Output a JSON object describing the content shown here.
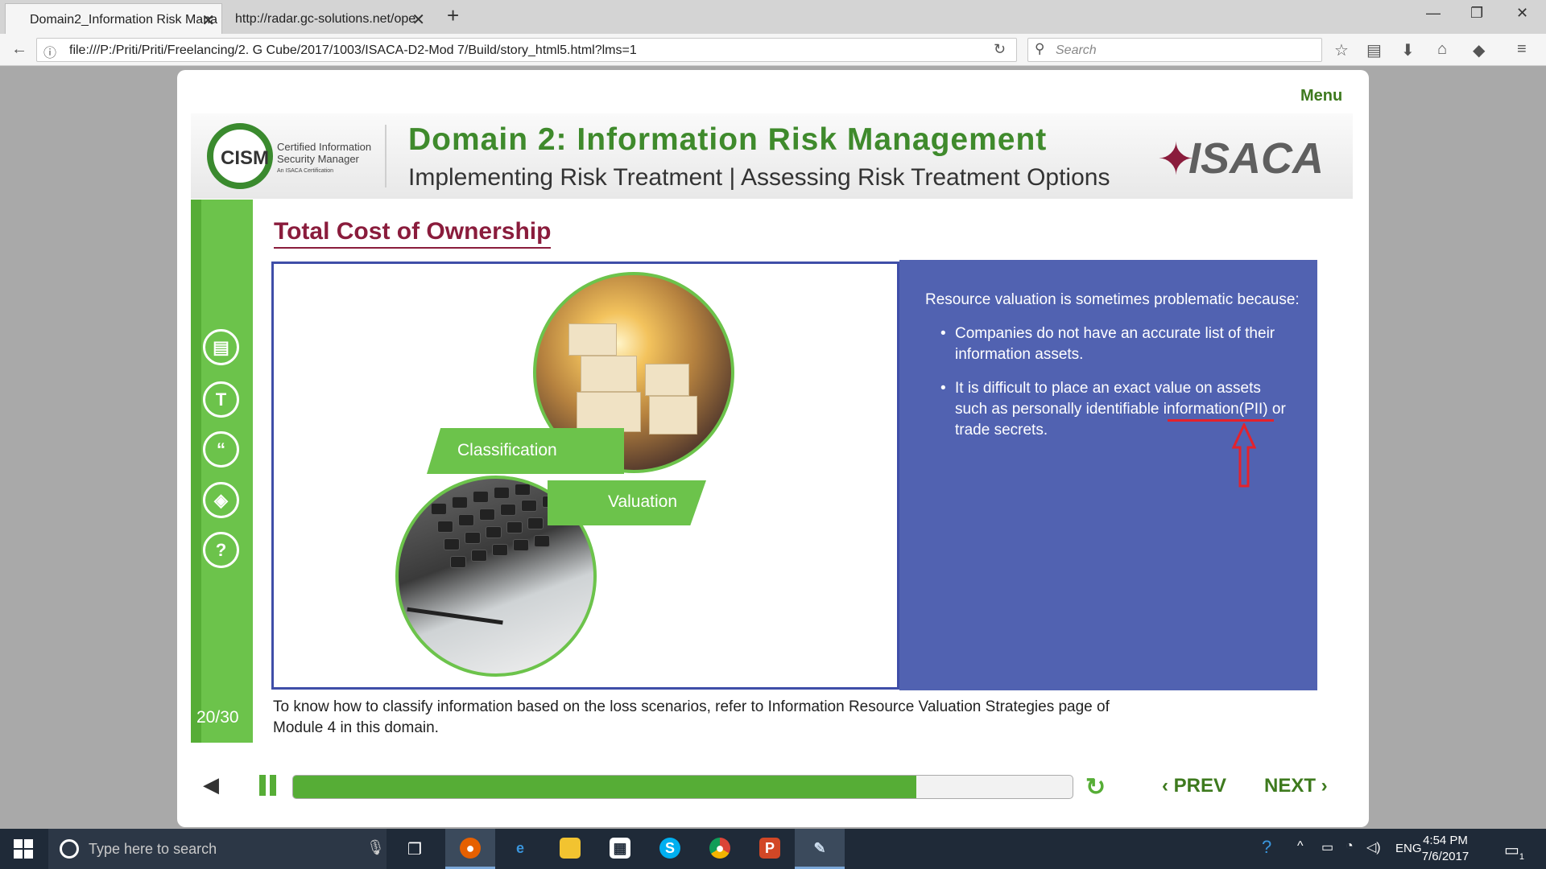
{
  "browser": {
    "tabs": [
      {
        "title": "Domain2_Information Risk Mana",
        "active": true
      },
      {
        "title": "http://radar.gc-solutions.net/ope",
        "active": false
      }
    ],
    "url": "file:///P:/Priti/Priti/Freelancing/2. G Cube/2017/1003/ISACA-D2-Mod 7/Build/story_html5.html?lms=1",
    "search_placeholder": "Search"
  },
  "player": {
    "menu_label": "Menu",
    "header": {
      "cism_abbr": "CISM",
      "cism_line1": "Certified Information",
      "cism_line2": "Security Manager",
      "cism_line3": "An ISACA Certification",
      "title": "Domain 2: Information Risk Management",
      "subtitle": "Implementing Risk Treatment | Assessing Risk Treatment Options",
      "brand": "ISACA"
    },
    "sidebar": {
      "icons": [
        "notes-icon",
        "transcript-icon",
        "quote-icon",
        "layers-icon",
        "help-icon"
      ],
      "page_num": "20/30"
    },
    "slide": {
      "title": "Total Cost of Ownership",
      "ribbon_classification": "Classification",
      "ribbon_valuation": "Valuation",
      "intro": "Resource valuation is sometimes problematic because:",
      "bullets": [
        "Companies do not have an accurate list of their information assets.",
        "It is difficult to place an exact value on assets such as personally identifiable information(PII) or trade secrets."
      ],
      "caption": "To know how to classify information based on the loss scenarios, refer to Information Resource Valuation Strategies page of Module 4 in this domain."
    },
    "controls": {
      "progress": 0.8,
      "prev_label": "PREV",
      "next_label": "NEXT"
    },
    "colors": {
      "green": "#6cc34b",
      "dark_green": "#3e7a1e",
      "maroon": "#8a1c3c",
      "panel_blue": "#5162b1",
      "annotation_red": "#e3222c"
    }
  },
  "taskbar": {
    "search_placeholder": "Type here to search",
    "apps": [
      "firefox-icon",
      "edge-icon",
      "file-explorer-icon",
      "store-icon",
      "skype-icon",
      "chrome-icon",
      "powerpoint-icon",
      "paint-icon"
    ],
    "lang": "ENG",
    "time": "4:54 PM",
    "date": "7/6/2017",
    "notif_count": "1"
  }
}
